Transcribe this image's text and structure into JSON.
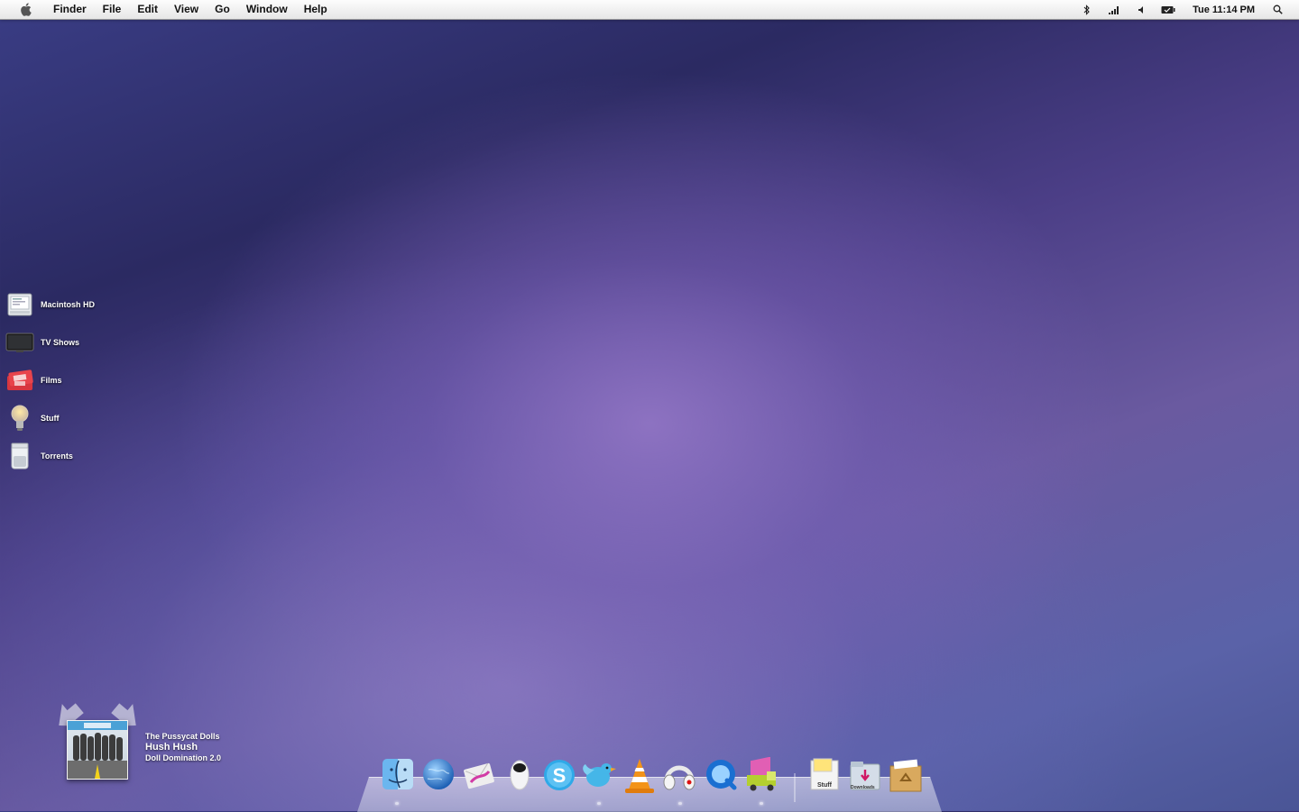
{
  "menubar": {
    "app_name": "Finder",
    "menus": [
      "File",
      "Edit",
      "View",
      "Go",
      "Window",
      "Help"
    ],
    "status_icons": [
      "bluetooth-icon",
      "wifi-signal-icon",
      "volume-icon",
      "battery-icon"
    ],
    "clock": "Tue 11:14 PM"
  },
  "desktop": {
    "icons": [
      {
        "label": "Macintosh HD",
        "icon": "hard-drive-icon"
      },
      {
        "label": "TV Shows",
        "icon": "tv-icon"
      },
      {
        "label": "Films",
        "icon": "ticket-icon"
      },
      {
        "label": "Stuff",
        "icon": "light-bulb-icon"
      },
      {
        "label": "Torrents",
        "icon": "jar-icon"
      }
    ]
  },
  "now_playing": {
    "artist": "The Pussycat Dolls",
    "title": "Hush Hush",
    "album": "Doll Domination 2.0"
  },
  "dock": {
    "apps": [
      "finder",
      "globe-browser",
      "mail",
      "wall-e",
      "skype",
      "twitter",
      "vlc",
      "headphones",
      "quicktime",
      "truck"
    ],
    "stacks": [
      "Stuff",
      "Downloads",
      "trash"
    ]
  },
  "colors": {
    "wallpaper_center": "#8a70b8",
    "wallpaper_edge": "#2b2a62",
    "menubar": "#f0f0f0"
  }
}
